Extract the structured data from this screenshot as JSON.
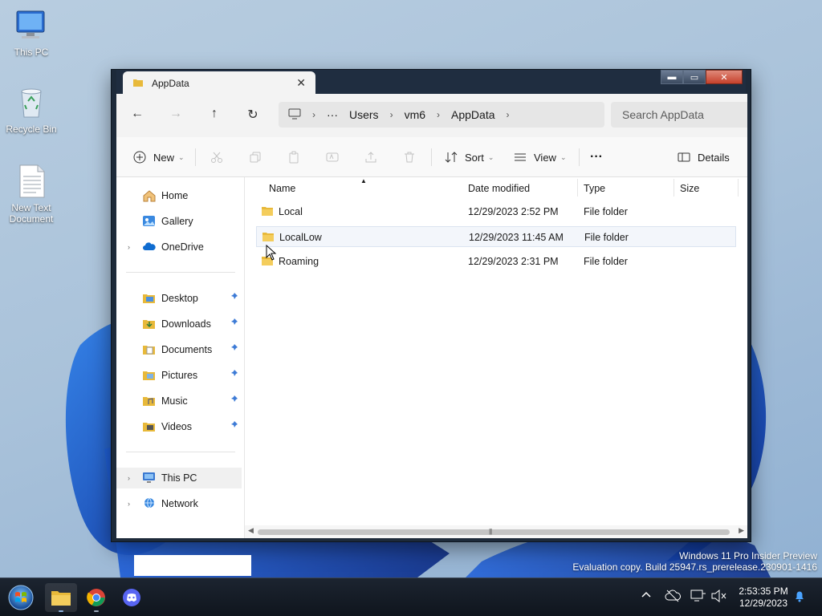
{
  "desktop": {
    "icons": [
      {
        "label": "This PC"
      },
      {
        "label": "Recycle Bin"
      },
      {
        "label": "New Text Document"
      }
    ]
  },
  "window": {
    "tab_title": "AppData",
    "tab_close": "✕",
    "caption": {
      "minimize": "▬",
      "maximize": "▭",
      "close": "✕"
    }
  },
  "address": {
    "back": "←",
    "forward": "→",
    "up": "↑",
    "refresh": "↻",
    "crumbs": [
      "Users",
      "vm6",
      "AppData"
    ],
    "ellipsis": "···",
    "sep": "›",
    "search_placeholder": "Search AppData"
  },
  "toolbar": {
    "new_label": "New",
    "sort_label": "Sort",
    "view_label": "View",
    "more_label": "···",
    "details_label": "Details",
    "chevron": "⌄"
  },
  "navpane": {
    "top": [
      {
        "label": "Home"
      },
      {
        "label": "Gallery"
      },
      {
        "label": "OneDrive"
      }
    ],
    "quick": [
      {
        "label": "Desktop"
      },
      {
        "label": "Downloads"
      },
      {
        "label": "Documents"
      },
      {
        "label": "Pictures"
      },
      {
        "label": "Music"
      },
      {
        "label": "Videos"
      }
    ],
    "bottom": [
      {
        "label": "This PC"
      },
      {
        "label": "Network"
      }
    ],
    "expander": "›",
    "pin": "📌"
  },
  "files": {
    "columns": {
      "name": "Name",
      "date": "Date modified",
      "type": "Type",
      "size": "Size"
    },
    "rows": [
      {
        "name": "Local",
        "date": "12/29/2023 2:52 PM",
        "type": "File folder"
      },
      {
        "name": "LocalLow",
        "date": "12/29/2023 11:45 AM",
        "type": "File folder"
      },
      {
        "name": "Roaming",
        "date": "12/29/2023 2:31 PM",
        "type": "File folder"
      }
    ]
  },
  "watermark": {
    "line1": "Windows 11 Pro Insider Preview",
    "line2": "Evaluation copy. Build 25947.rs_prerelease.230901-1416"
  },
  "taskbar": {
    "time": "2:53:35 PM",
    "date": "12/29/2023",
    "tray_chevron": "^"
  },
  "colors": {
    "accent": "#0067c0",
    "folder": "#e8b93a",
    "taskbar": "#141b24"
  }
}
